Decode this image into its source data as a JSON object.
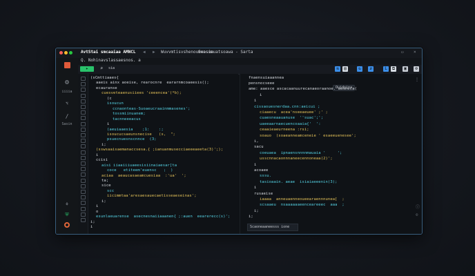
{
  "window": {
    "title": "AvtStai smcaaiaa AMNCL",
    "tab_title": "Q. Nohinavslassaesnos. a",
    "breadcrumb_a": "Wuvvmtisvshenouenosia",
    "breadcrumb_b": "Swasumuatsoawa - Sarta"
  },
  "toolbar": {
    "run_label": "▸",
    "search_label": "sia"
  },
  "activity": {
    "label_a": "iiiia",
    "label_b": "Sasin"
  },
  "left_editor": {
    "lines": [
      {
        "t": "(sCmttiaaes{",
        "c": "w",
        "i": 0
      },
      {
        "t": "aaeis ainx aoeise, rearocnre  eararnmcoaeesis();",
        "c": "w",
        "i": 1
      },
      {
        "t": "ecauranse",
        "c": "w",
        "i": 1
      },
      {
        "t": "cuesveteaenusiiees 'ceeencea'(*b);",
        "c": "y",
        "i": 2
      },
      {
        "t": "(c",
        "c": "w",
        "i": 3
      },
      {
        "t": "isoucun",
        "c": "c",
        "i": 3
      },
      {
        "t": "ccnaonteas-Suoaeucraainmmasenes';",
        "c": "c",
        "i": 4
      },
      {
        "t": "tossmiinuanem;",
        "c": "c",
        "i": 4
      },
      {
        "t": "tacnneeeacus",
        "c": "c",
        "i": 4
      },
      {
        "t": "i",
        "c": "w",
        "i": 3
      },
      {
        "t": "(aeuiaaesia    ;1:    :;",
        "c": "c",
        "i": 3
      },
      {
        "t": "isoucucsaeunsnecise   (s,  \";",
        "c": "y",
        "i": 3
      },
      {
        "t": "psuecnuesnscnnce  (3;",
        "c": "c",
        "i": 3
      },
      {
        "t": "i;",
        "c": "w",
        "i": 2
      },
      {
        "t": "(sswsaaisaemanaccsesa.{ ;ianuanmusecciaeeeaeeta(3)';);",
        "c": "y",
        "i": 1
      },
      {
        "t": "i",
        "c": "w",
        "i": 1
      },
      {
        "t": "ccisi",
        "c": "w",
        "i": 1
      },
      {
        "t": "aisi iiaaiiiuaeesisiinaiaesar[ta",
        "c": "c",
        "i": 2
      },
      {
        "t": "coce   etiteem'euensc   ;  )",
        "c": "c",
        "i": 3
      },
      {
        "t": "aciaa  aeaucasaeamcuesiaa  :'ua'  ';",
        "c": "y",
        "i": 2
      },
      {
        "t": "ta;",
        "c": "w",
        "i": 2
      },
      {
        "t": "sice",
        "c": "w",
        "i": 2
      },
      {
        "t": "scc",
        "c": "c",
        "i": 3
      },
      {
        "t": "iicimmtaa'aresaesauecaetisseaeseinas';",
        "c": "y",
        "i": 3
      },
      {
        "t": "i;",
        "c": "w",
        "i": 2
      },
      {
        "t": "i",
        "c": "w",
        "i": 1
      },
      {
        "t": "o",
        "c": "w",
        "i": 1
      },
      {
        "t": "esunlaeuarense  asecnesnaiiaaanen{ ;:auen  eearerecc(s)';",
        "c": "c",
        "i": 1
      },
      {
        "t": "i;",
        "c": "w",
        "i": 0
      },
      {
        "t": "i",
        "c": "w",
        "i": 0
      }
    ]
  },
  "right_editor": {
    "header": "fnaensuiaaannea",
    "badge": "Ouidoina",
    "status": "Scaoneaaneesss ione",
    "lines": [
      {
        "t": "pensnocseee",
        "c": "w",
        "i": 0
      },
      {
        "t": "ame: aaesce ascacaanuurecanaeoraanoe. aemneca(",
        "c": "w",
        "i": 0
      },
      {
        "t": "i",
        "c": "w",
        "i": 2
      },
      {
        "t": "i",
        "c": "w",
        "i": 1
      },
      {
        "t": "cissaouesnerdaa.cnn:aeicui ;",
        "c": "c",
        "i": 1
      },
      {
        "t": "ciaaecu  acea'nseeaeuee' ;' ;",
        "c": "y",
        "i": 2
      },
      {
        "t": "cuaesneaauanuse  ''suac';';",
        "c": "c",
        "i": 2
      },
      {
        "t": "uaeeaarnaecuencoaaia{'  ':",
        "c": "c",
        "i": 2
      },
      {
        "t": "ceaaieaeurneena :rsi;",
        "c": "y",
        "i": 2
      },
      {
        "t": "soauo  (soaeanneamceneie ' esaeeuenesee';",
        "c": "y",
        "i": 2
      },
      {
        "t": "i,",
        "c": "w",
        "i": 1
      },
      {
        "t": "sacu",
        "c": "w",
        "i": 1
      },
      {
        "t": "coeuaea  ipnaensnnnnmauaia '     ';",
        "c": "c",
        "i": 2
      },
      {
        "t": "usscnnacaonnnaneecennoneaa(2)';",
        "c": "y",
        "i": 2
      },
      {
        "t": "i",
        "c": "w",
        "i": 1
      },
      {
        "t": "acoaee",
        "c": "w",
        "i": 1
      },
      {
        "t": "sssu.",
        "c": "c",
        "i": 2
      },
      {
        "t": "tasioaain. aeae  isiaiaeeenin(3);",
        "c": "c",
        "i": 2
      },
      {
        "t": "i",
        "c": "w",
        "i": 1
      },
      {
        "t": "rusaeise",
        "c": "w",
        "i": 1
      },
      {
        "t": "iaaaa  anneuaenneoueearaennnunea[  ;",
        "c": "y",
        "i": 2
      },
      {
        "t": "scsaaeu  nsaaaaaaeenceareeec  aaa  ;",
        "c": "c",
        "i": 2
      },
      {
        "t": "i;",
        "c": "w",
        "i": 1
      },
      {
        "t": "i;",
        "c": "w",
        "i": 0
      }
    ]
  },
  "colors": {
    "accent": "#3a5f7f",
    "green": "#29c26b"
  }
}
